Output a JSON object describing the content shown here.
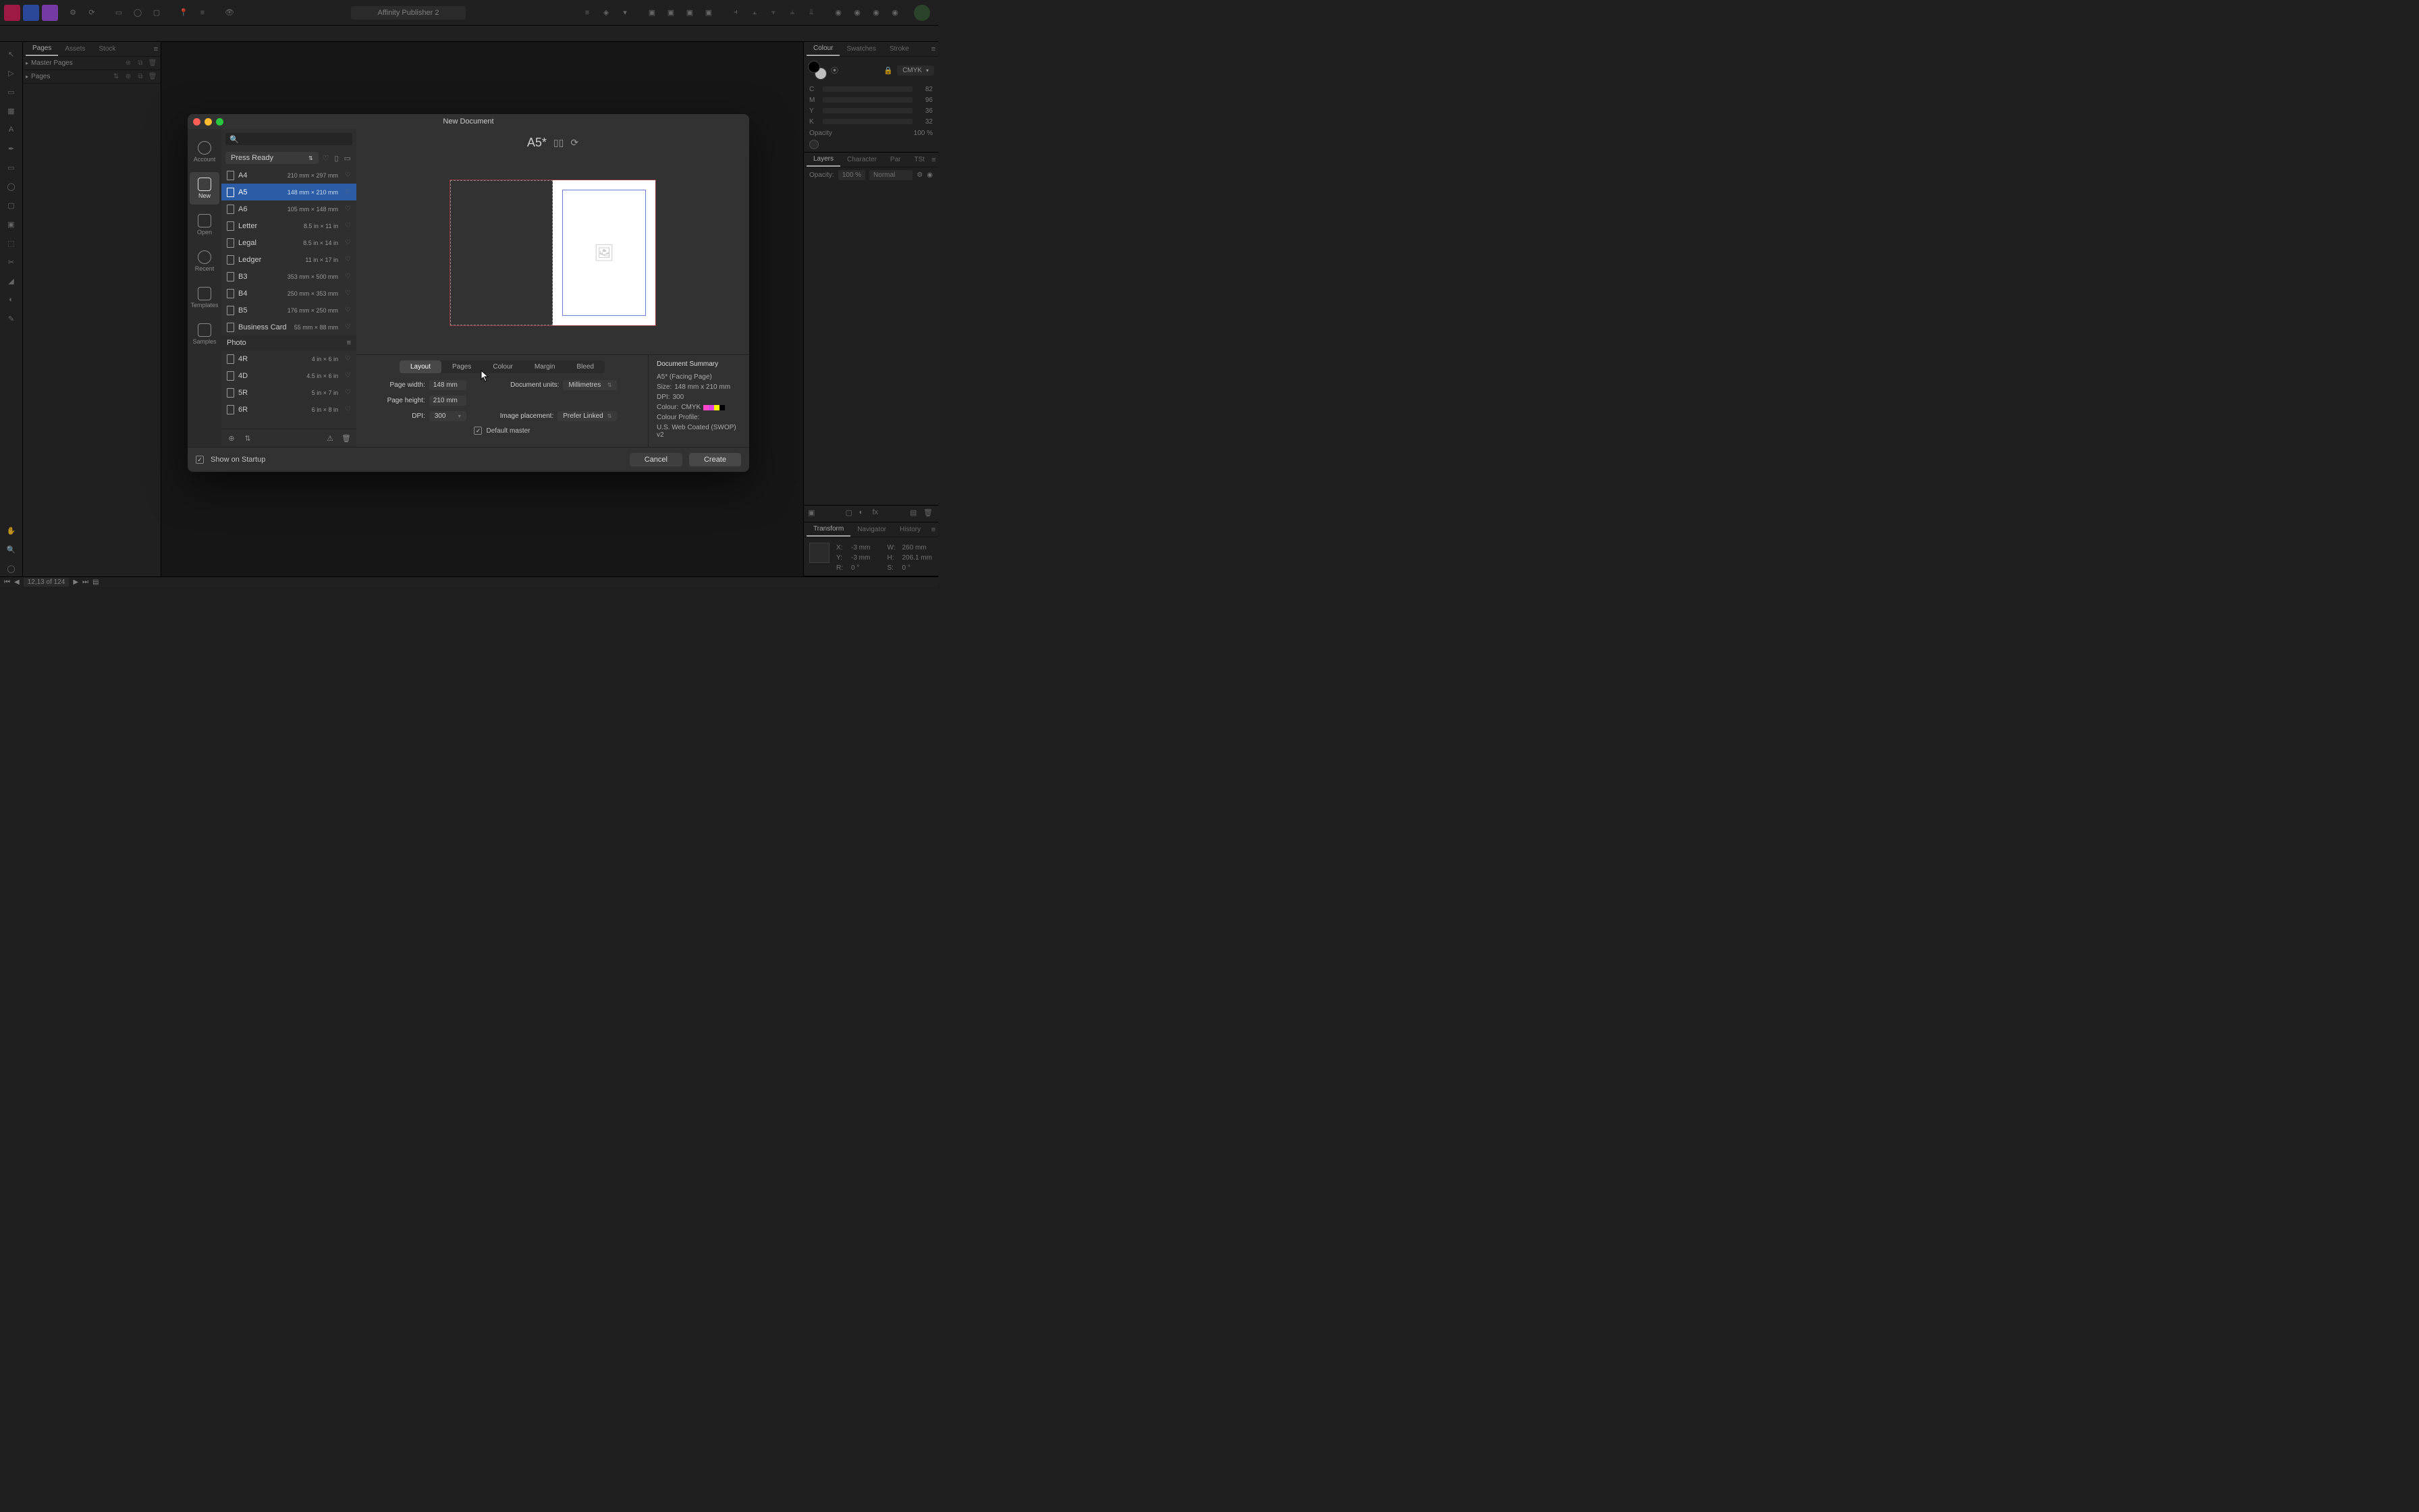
{
  "app_title": "Affinity Publisher 2",
  "left_studio": {
    "tabs": [
      "Pages",
      "Assets",
      "Stock"
    ],
    "active_tab": 0,
    "sections": {
      "master": "Master Pages",
      "pages": "Pages"
    }
  },
  "right_studio": {
    "colour_tabs": [
      "Colour",
      "Swatches",
      "Stroke"
    ],
    "colour_active": 0,
    "colour_model": "CMYK",
    "channels": [
      {
        "label": "C",
        "value": "82"
      },
      {
        "label": "M",
        "value": "96"
      },
      {
        "label": "Y",
        "value": "36"
      },
      {
        "label": "K",
        "value": "32"
      }
    ],
    "opacity_label": "Opacity",
    "opacity_value": "100 %",
    "layers_tabs": [
      "Layers",
      "Character",
      "Par",
      "TSt"
    ],
    "layers_active": 0,
    "layers_opacity_label": "Opacity:",
    "layers_opacity_value": "100 %",
    "blend_mode": "Normal",
    "transform_tabs": [
      "Transform",
      "Navigator",
      "History"
    ],
    "transform_active": 0,
    "transform": {
      "x_label": "X:",
      "x_value": "-3 mm",
      "y_label": "Y:",
      "y_value": "-3 mm",
      "w_label": "W:",
      "w_value": "260 mm",
      "h_label": "H:",
      "h_value": "206.1 mm",
      "r_label": "R:",
      "r_value": "0 °",
      "s_label": "S:",
      "s_value": "0 °"
    }
  },
  "footer": {
    "page_indicator": "12,13 of 124"
  },
  "modal": {
    "title": "New Document",
    "side_items": [
      "Account",
      "New",
      "Open",
      "Recent",
      "Templates",
      "Samples"
    ],
    "side_active": 1,
    "search_placeholder": "",
    "category": "Press Ready",
    "section_photo": "Photo",
    "presets": [
      {
        "name": "A4",
        "dim": "210 mm × 297 mm"
      },
      {
        "name": "A5",
        "dim": "148 mm × 210 mm"
      },
      {
        "name": "A6",
        "dim": "105 mm × 148 mm"
      },
      {
        "name": "Letter",
        "dim": "8.5 in × 11 in"
      },
      {
        "name": "Legal",
        "dim": "8.5 in × 14 in"
      },
      {
        "name": "Ledger",
        "dim": "11 in × 17 in"
      },
      {
        "name": "B3",
        "dim": "353 mm × 500 mm"
      },
      {
        "name": "B4",
        "dim": "250 mm × 353 mm"
      },
      {
        "name": "B5",
        "dim": "176 mm × 250 mm"
      },
      {
        "name": "Business Card",
        "dim": "55 mm × 88 mm"
      }
    ],
    "photo_presets": [
      {
        "name": "4R",
        "dim": "4 in × 6 in"
      },
      {
        "name": "4D",
        "dim": "4.5 in × 6 in"
      },
      {
        "name": "5R",
        "dim": "5 in × 7 in"
      },
      {
        "name": "6R",
        "dim": "6 in × 8 in"
      }
    ],
    "preset_selected": 1,
    "preview_title": "A5*",
    "settings_tabs": [
      "Layout",
      "Pages",
      "Colour",
      "Margin",
      "Bleed"
    ],
    "settings_active": 0,
    "fields": {
      "page_width_label": "Page width:",
      "page_width": "148 mm",
      "page_height_label": "Page height:",
      "page_height": "210 mm",
      "dpi_label": "DPI:",
      "dpi": "300",
      "units_label": "Document units:",
      "units": "Millimetres",
      "placement_label": "Image placement:",
      "placement": "Prefer Linked",
      "default_master": "Default master"
    },
    "summary": {
      "title": "Document Summary",
      "preset": "A5* (Facing Page)",
      "size_label": "Size:",
      "size": "148 mm x 210 mm",
      "dpi_label": "DPI:",
      "dpi": "300",
      "colour_label": "Colour:",
      "colour": "CMYK",
      "profile_label": "Colour Profile:",
      "profile": "U.S. Web Coated (SWOP) v2"
    },
    "show_startup": "Show on Startup",
    "cancel": "Cancel",
    "create": "Create"
  }
}
